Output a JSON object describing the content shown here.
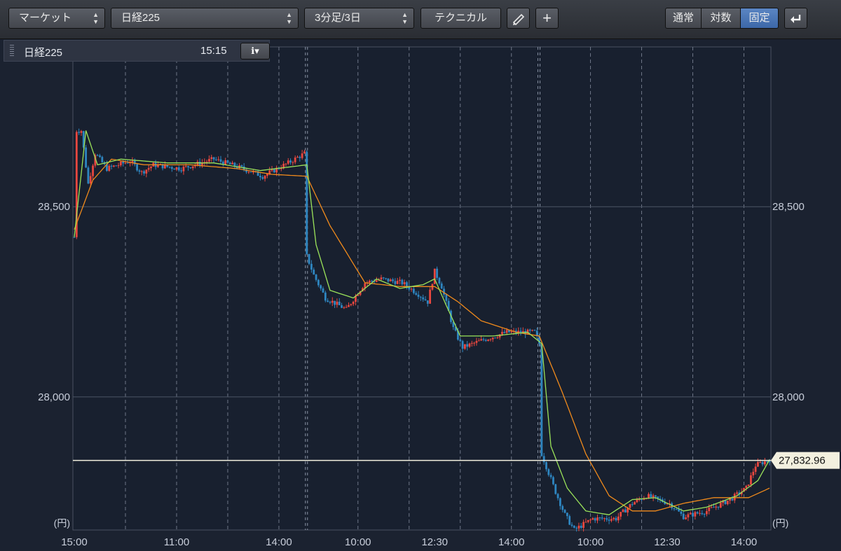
{
  "toolbar": {
    "market_label": "マーケット",
    "symbol": "日経225",
    "period": "3分足/3日",
    "technical_label": "テクニカル",
    "draw_icon": "pencil-icon",
    "crosshair_icon": "plus-icon",
    "scale_modes": [
      "通常",
      "対数",
      "固定"
    ],
    "active_scale": "固定",
    "return_icon": "return-arrow-icon"
  },
  "info": {
    "title": "日経225",
    "time": "15:15",
    "info_icon": "info-dropdown-icon"
  },
  "colors": {
    "up": "#e8473f",
    "down": "#2e86c1",
    "ma_short": "#9be35a",
    "ma_long": "#f08a1c",
    "current_line": "#f3f0df"
  },
  "chart_data": {
    "type": "candlestick",
    "ylim": [
      27650,
      28920
    ],
    "y_ticks": [
      28000,
      28500
    ],
    "y_tick_labels": [
      "28,000",
      "28,500"
    ],
    "y_unit": "(円)",
    "x_labels": [
      "15:00",
      "11:00",
      "14:00",
      "10:00",
      "12:30",
      "14:00",
      "10:00",
      "12:30",
      "14:00"
    ],
    "current_price": 27832.96,
    "current_price_label": "27,832.96",
    "price_path": [
      [
        0,
        28420
      ],
      [
        1,
        28700
      ],
      [
        3,
        28700
      ],
      [
        6,
        28560
      ],
      [
        9,
        28640
      ],
      [
        14,
        28600
      ],
      [
        24,
        28620
      ],
      [
        29,
        28590
      ],
      [
        34,
        28610
      ],
      [
        46,
        28600
      ],
      [
        60,
        28625
      ],
      [
        75,
        28595
      ],
      [
        81,
        28580
      ],
      [
        92,
        28615
      ],
      [
        99,
        28640
      ],
      [
        100,
        28370
      ],
      [
        103,
        28320
      ],
      [
        108,
        28260
      ],
      [
        117,
        28230
      ],
      [
        125,
        28300
      ],
      [
        132,
        28310
      ],
      [
        141,
        28300
      ],
      [
        148,
        28270
      ],
      [
        152,
        28250
      ],
      [
        155,
        28330
      ],
      [
        158,
        28290
      ],
      [
        163,
        28180
      ],
      [
        167,
        28130
      ],
      [
        176,
        28150
      ],
      [
        186,
        28170
      ],
      [
        198,
        28170
      ],
      [
        200,
        28140
      ],
      [
        201,
        27850
      ],
      [
        207,
        27750
      ],
      [
        211,
        27690
      ],
      [
        215,
        27650
      ],
      [
        223,
        27680
      ],
      [
        233,
        27680
      ],
      [
        240,
        27720
      ],
      [
        246,
        27740
      ],
      [
        256,
        27720
      ],
      [
        262,
        27685
      ],
      [
        272,
        27700
      ],
      [
        282,
        27730
      ],
      [
        289,
        27760
      ],
      [
        293,
        27820
      ],
      [
        299,
        27835
      ]
    ],
    "ma_short": [
      [
        0,
        28420
      ],
      [
        5,
        28700
      ],
      [
        10,
        28610
      ],
      [
        20,
        28625
      ],
      [
        40,
        28615
      ],
      [
        60,
        28615
      ],
      [
        80,
        28595
      ],
      [
        100,
        28610
      ],
      [
        104,
        28400
      ],
      [
        110,
        28280
      ],
      [
        120,
        28260
      ],
      [
        130,
        28310
      ],
      [
        140,
        28285
      ],
      [
        150,
        28295
      ],
      [
        155,
        28310
      ],
      [
        160,
        28240
      ],
      [
        166,
        28160
      ],
      [
        180,
        28160
      ],
      [
        195,
        28170
      ],
      [
        201,
        28140
      ],
      [
        205,
        27870
      ],
      [
        212,
        27760
      ],
      [
        220,
        27700
      ],
      [
        230,
        27690
      ],
      [
        240,
        27730
      ],
      [
        250,
        27735
      ],
      [
        262,
        27700
      ],
      [
        272,
        27710
      ],
      [
        285,
        27740
      ],
      [
        294,
        27780
      ],
      [
        299,
        27835
      ]
    ],
    "ma_long": [
      [
        0,
        28440
      ],
      [
        8,
        28570
      ],
      [
        16,
        28625
      ],
      [
        30,
        28610
      ],
      [
        50,
        28610
      ],
      [
        70,
        28600
      ],
      [
        85,
        28585
      ],
      [
        100,
        28580
      ],
      [
        110,
        28450
      ],
      [
        125,
        28300
      ],
      [
        140,
        28290
      ],
      [
        155,
        28290
      ],
      [
        165,
        28250
      ],
      [
        175,
        28200
      ],
      [
        190,
        28170
      ],
      [
        200,
        28160
      ],
      [
        210,
        28010
      ],
      [
        220,
        27850
      ],
      [
        230,
        27740
      ],
      [
        240,
        27700
      ],
      [
        250,
        27700
      ],
      [
        262,
        27720
      ],
      [
        275,
        27735
      ],
      [
        290,
        27735
      ],
      [
        299,
        27760
      ]
    ]
  }
}
